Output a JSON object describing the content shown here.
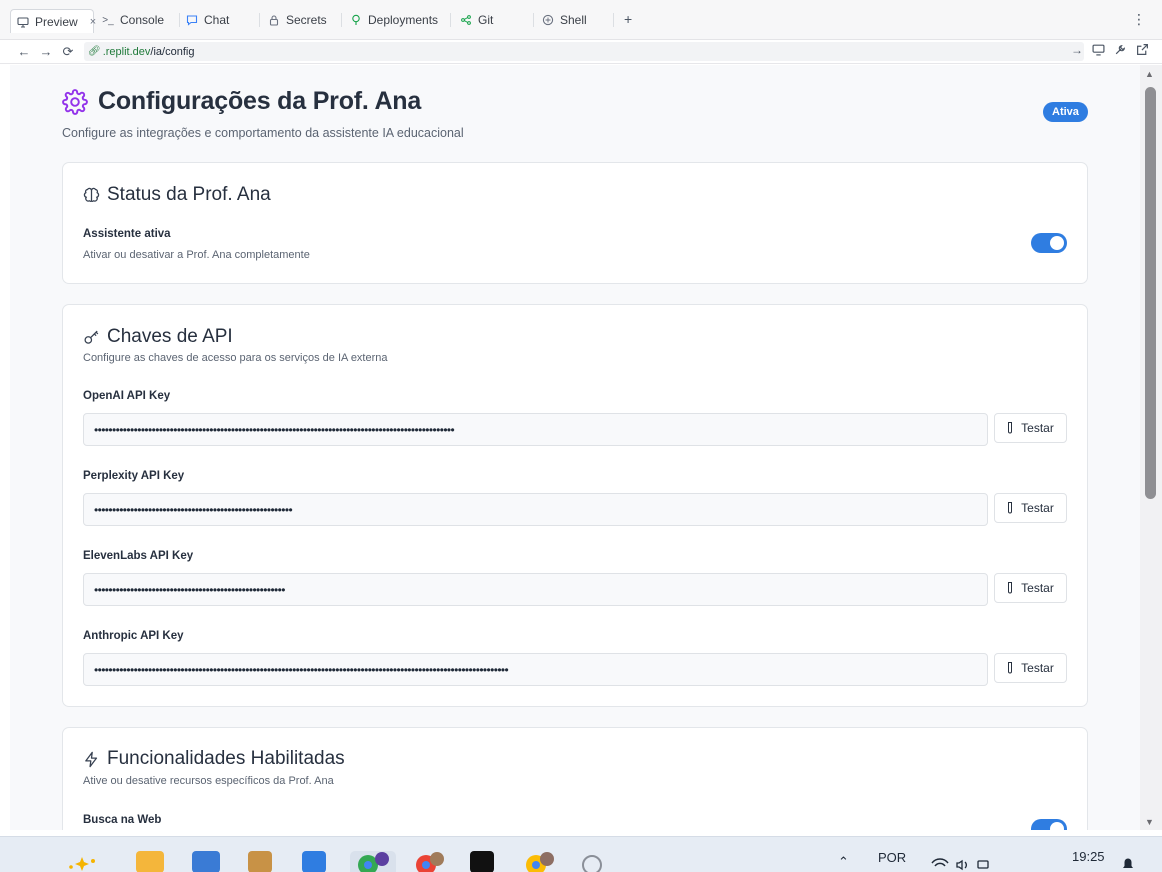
{
  "tabs": [
    {
      "label": "Preview",
      "icon": "monitor-icon",
      "active": true
    },
    {
      "label": "Console",
      "icon": "terminal-icon"
    },
    {
      "label": "Chat",
      "icon": "chat-icon"
    },
    {
      "label": "Secrets",
      "icon": "lock-icon"
    },
    {
      "label": "Deployments",
      "icon": "deploy-icon"
    },
    {
      "label": "Git",
      "icon": "git-icon"
    },
    {
      "label": "Shell",
      "icon": "shell-icon"
    }
  ],
  "url": {
    "host": ".replit.dev",
    "path": "/ia/config"
  },
  "page": {
    "title": "Configurações da Prof. Ana",
    "subtitle": "Configure as integrações e comportamento da assistente IA educacional",
    "badge": "Ativa"
  },
  "status_card": {
    "title": "Status da Prof. Ana",
    "label": "Assistente ativa",
    "description": "Ativar ou desativar a Prof. Ana completamente",
    "enabled": true
  },
  "api_card": {
    "title": "Chaves de API",
    "description": "Configure as chaves de acesso para os serviços de IA externa",
    "test_label": "Testar",
    "keys": [
      {
        "label": "OpenAI API Key",
        "value": "••••••••••••••••••••••••••••••••••••••••••••••••••••••••••••••••••••••••••••••••••••••••••••••••••••"
      },
      {
        "label": "Perplexity API Key",
        "value": "•••••••••••••••••••••••••••••••••••••••••••••••••••••••"
      },
      {
        "label": "ElevenLabs API Key",
        "value": "•••••••••••••••••••••••••••••••••••••••••••••••••••••"
      },
      {
        "label": "Anthropic API Key",
        "value": "•••••••••••••••••••••••••••••••••••••••••••••••••••••••••••••••••••••••••••••••••••••••••••••••••••••••••••••••••••"
      }
    ]
  },
  "features_card": {
    "title": "Funcionalidades Habilitadas",
    "description": "Ative ou desative recursos específicos da Prof. Ana",
    "first_item": "Busca na Web"
  },
  "taskbar": {
    "language": "POR",
    "time": "19:25"
  },
  "colors": {
    "accent": "#2f7de1",
    "gear": "#9333ea"
  }
}
